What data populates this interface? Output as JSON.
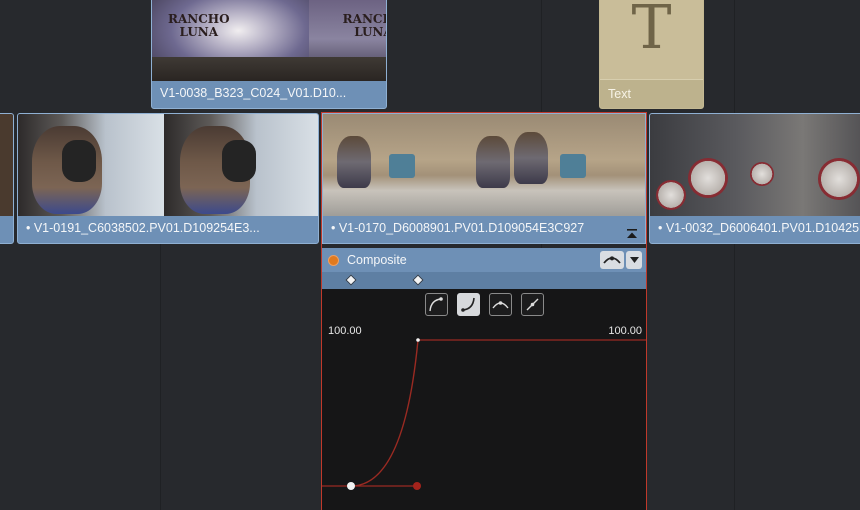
{
  "timeline": {
    "clips": [
      {
        "id": "top",
        "label": "V1-0038_B323_C024_V01.D10...",
        "sign_lines": [
          "RANCHO",
          "LUNA"
        ]
      },
      {
        "id": "text",
        "label": "Text",
        "glyph": "T"
      },
      {
        "id": "left",
        "label": "• V1-0191_C6038502.PV01.D109254E3..."
      },
      {
        "id": "selected",
        "label": "• V1-0170_D6008901.PV01.D109054E3C927"
      },
      {
        "id": "right",
        "label": "• V1-0032_D6006401.PV01.D10425"
      }
    ]
  },
  "inspector": {
    "title": "Composite",
    "curve_tools": [
      "ease-in-curve-icon",
      "ease-out-curve-icon",
      "bezier-peak-icon",
      "linear-curve-icon"
    ],
    "active_tool_index": 1,
    "keyframe_count": 2
  },
  "graph": {
    "left_value": "100.00",
    "right_value": "100.00"
  },
  "colors": {
    "background": "#27292d",
    "clip_blue": "#6e90b6",
    "selection_red": "#c0392b",
    "text_clip": "#d7ceae"
  }
}
